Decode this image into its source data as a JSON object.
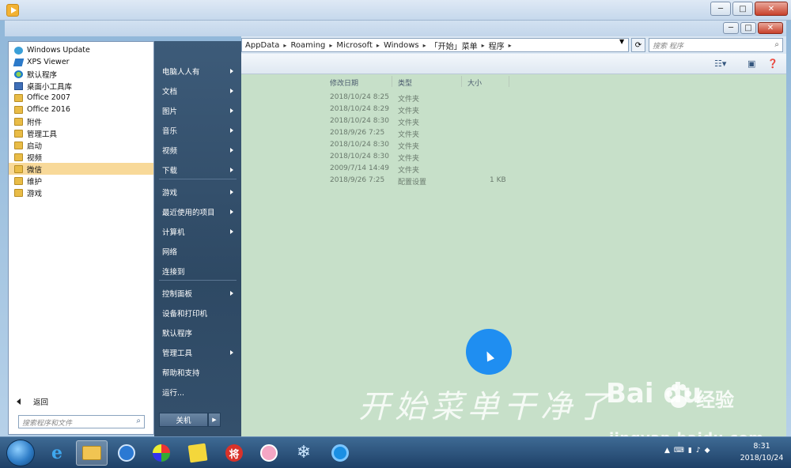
{
  "explorer": {
    "breadcrumb": [
      "AppData",
      "Roaming",
      "Microsoft",
      "Windows",
      "「开始」菜单",
      "程序"
    ],
    "search_placeholder": "搜索 程序",
    "columns": {
      "date": "修改日期",
      "type": "类型",
      "size": "大小"
    },
    "rows": [
      {
        "date": "2018/10/24 8:25",
        "type": "文件夹",
        "size": ""
      },
      {
        "date": "2018/10/24 8:29",
        "type": "文件夹",
        "size": ""
      },
      {
        "date": "2018/10/24 8:30",
        "type": "文件夹",
        "size": ""
      },
      {
        "date": "2018/9/26 7:25",
        "type": "文件夹",
        "size": ""
      },
      {
        "date": "2018/10/24 8:30",
        "type": "文件夹",
        "size": ""
      },
      {
        "date": "2018/10/24 8:30",
        "type": "文件夹",
        "size": ""
      },
      {
        "date": "2009/7/14 14:49",
        "type": "文件夹",
        "size": ""
      },
      {
        "date": "2018/9/26 7:25",
        "type": "配置设置",
        "size": "1 KB"
      }
    ]
  },
  "start_menu": {
    "programs": [
      {
        "label": "Windows Update",
        "icon": "update"
      },
      {
        "label": "XPS Viewer",
        "icon": "xps"
      },
      {
        "label": "默认程序",
        "icon": "defprog"
      },
      {
        "label": "桌面小工具库",
        "icon": "gadget"
      },
      {
        "label": "Office 2007",
        "icon": "folder"
      },
      {
        "label": "Office 2016",
        "icon": "folder"
      },
      {
        "label": "附件",
        "icon": "folder"
      },
      {
        "label": "管理工具",
        "icon": "folder"
      },
      {
        "label": "启动",
        "icon": "folder"
      },
      {
        "label": "视频",
        "icon": "folder"
      },
      {
        "label": "微信",
        "icon": "folder"
      },
      {
        "label": "维护",
        "icon": "folder"
      },
      {
        "label": "游戏",
        "icon": "folder"
      }
    ],
    "selected_program": "微信",
    "back_label": "返回",
    "search_placeholder": "搜索程序和文件",
    "places": [
      {
        "label": "电脑人人有",
        "submenu": true
      },
      {
        "label": "文档",
        "submenu": true
      },
      {
        "label": "图片",
        "submenu": true
      },
      {
        "label": "音乐",
        "submenu": true
      },
      {
        "label": "视频",
        "submenu": true
      },
      {
        "label": "下载",
        "submenu": true
      },
      {
        "label": "游戏",
        "submenu": true
      },
      {
        "label": "最近使用的项目",
        "submenu": true
      },
      {
        "label": "计算机",
        "submenu": true
      },
      {
        "label": "网络",
        "submenu": false
      },
      {
        "label": "连接到",
        "submenu": false
      },
      {
        "label": "控制面板",
        "submenu": true
      },
      {
        "label": "设备和打印机",
        "submenu": false
      },
      {
        "label": "默认程序",
        "submenu": false
      },
      {
        "label": "管理工具",
        "submenu": true
      },
      {
        "label": "帮助和支持",
        "submenu": false
      },
      {
        "label": "运行...",
        "submenu": false
      }
    ],
    "shutdown_label": "关机"
  },
  "overlay_caption": "开始菜单干净了",
  "watermark": {
    "brand": "Bai du",
    "cn": "经验",
    "url": "jingyan.baidu.com"
  },
  "taskbar": {
    "apps": [
      "ie",
      "explorer",
      "app-blue-circle",
      "paint",
      "yellow-note",
      "chess-jiang",
      "pink-app",
      "snowflake-app",
      "qq-browser"
    ],
    "chess_char": "将",
    "time": "8:31",
    "date": "2018/10/24"
  },
  "colors": {
    "content_bg": "#c7e0c9",
    "selection": "#f8d999",
    "accent": "#1f8ef1"
  }
}
